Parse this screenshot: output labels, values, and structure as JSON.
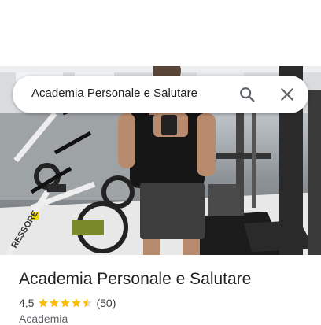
{
  "search": {
    "query": "Academia Personale e Salutare"
  },
  "place": {
    "name": "Academia Personale e Salutare",
    "rating": "4,5",
    "rating_fraction": 0.9,
    "review_count": "(50)",
    "category": "Academia"
  },
  "photo": {
    "bike_brand_text": "RESSORE"
  },
  "icons": {
    "search": "search-icon",
    "close": "close-icon",
    "star": "star-icon"
  },
  "colors": {
    "star": "#fbbc04",
    "star_empty": "#dadce0",
    "text": "#202124",
    "muted": "#5f6368"
  }
}
